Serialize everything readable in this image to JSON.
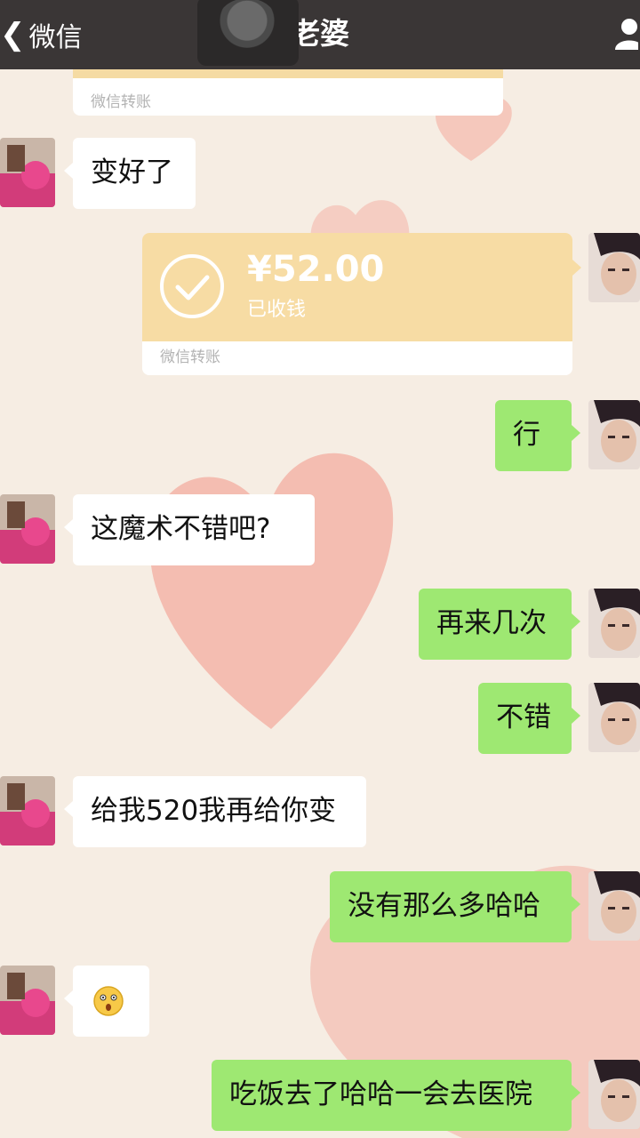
{
  "header": {
    "back_label": "微信",
    "title": "老婆"
  },
  "messages": {
    "transfer_prev_source": "微信转账",
    "m1": "变好了",
    "transfer": {
      "amount": "¥52.00",
      "status": "已收钱",
      "source": "微信转账"
    },
    "m2": "行",
    "m3": "这魔术不错吧?",
    "m4": "再来几次",
    "m5": "不错",
    "m6": "给我520我再给你变",
    "m7": "没有那么多哈哈",
    "m8_emoji": "surprised-face-emoji",
    "m9": "吃饭去了哈哈一会去医院"
  },
  "colors": {
    "header_bg": "#3a3636",
    "my_bubble": "#9ee872",
    "their_bubble": "#ffffff",
    "transfer_card": "#f7dca4",
    "chat_bg": "#f6ede3"
  }
}
